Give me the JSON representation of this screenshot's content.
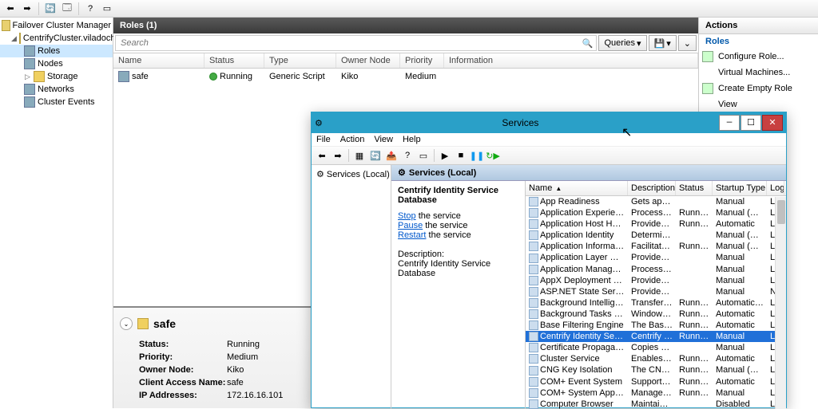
{
  "app": {
    "name": "Failover Cluster Manager"
  },
  "tree": {
    "root": "Failover Cluster Manager",
    "cluster": "CentrifyCluster.viladochave...",
    "items": [
      "Roles",
      "Nodes",
      "Storage",
      "Networks",
      "Cluster Events"
    ]
  },
  "roles": {
    "title": "Roles (1)",
    "search_ph": "Search",
    "queries": "Queries",
    "cols": {
      "name": "Name",
      "status": "Status",
      "type": "Type",
      "owner": "Owner Node",
      "priority": "Priority",
      "info": "Information"
    },
    "row": {
      "name": "safe",
      "status": "Running",
      "type": "Generic Script",
      "owner": "Kiko",
      "priority": "Medium",
      "info": ""
    }
  },
  "detail": {
    "name": "safe",
    "labels": {
      "status": "Status:",
      "priority": "Priority:",
      "owner": "Owner Node:",
      "client": "Client Access Name:",
      "ip": "IP Addresses:"
    },
    "values": {
      "status": "Running",
      "priority": "Medium",
      "owner": "Kiko",
      "client": "safe",
      "ip": "172.16.16.101"
    }
  },
  "actions": {
    "title": "Actions",
    "heading": "Roles",
    "items": [
      "Configure Role...",
      "Virtual Machines...",
      "Create Empty Role",
      "View"
    ]
  },
  "svc": {
    "title": "Services",
    "menu": [
      "File",
      "Action",
      "View",
      "Help"
    ],
    "tree": "Services (Local)",
    "pane_title": "Services (Local)",
    "selected_name": "Centrify Identity Service Database",
    "links": {
      "stop": "Stop",
      "pause": "Pause",
      "restart": "Restart"
    },
    "link_suffix": " the service",
    "desc_label": "Description:",
    "desc_text": "Centrify Identity Service Database",
    "cols": {
      "name": "Name",
      "desc": "Description",
      "status": "Status",
      "startup": "Startup Type",
      "log": "Log"
    },
    "rows": [
      {
        "name": "App Readiness",
        "desc": "Gets apps re...",
        "status": "",
        "startup": "Manual",
        "log": "Loc"
      },
      {
        "name": "Application Experience",
        "desc": "Processes a...",
        "status": "Running",
        "startup": "Manual (Trig...",
        "log": "Loc"
      },
      {
        "name": "Application Host Helper Ser...",
        "desc": "Provides ad...",
        "status": "Running",
        "startup": "Automatic",
        "log": "Loc"
      },
      {
        "name": "Application Identity",
        "desc": "Determines ...",
        "status": "",
        "startup": "Manual (Trig...",
        "log": "Loc"
      },
      {
        "name": "Application Information",
        "desc": "Facilitates t...",
        "status": "Running",
        "startup": "Manual (Trig...",
        "log": "Loc"
      },
      {
        "name": "Application Layer Gateway ...",
        "desc": "Provides su...",
        "status": "",
        "startup": "Manual",
        "log": "Loc"
      },
      {
        "name": "Application Management",
        "desc": "Processes in...",
        "status": "",
        "startup": "Manual",
        "log": "Loc"
      },
      {
        "name": "AppX Deployment Service (...",
        "desc": "Provides inf...",
        "status": "",
        "startup": "Manual",
        "log": "Loc"
      },
      {
        "name": "ASP.NET State Service",
        "desc": "Provides su...",
        "status": "",
        "startup": "Manual",
        "log": "Net"
      },
      {
        "name": "Background Intelligent Tran...",
        "desc": "Transfers fil...",
        "status": "Running",
        "startup": "Automatic (D...",
        "log": "Loc"
      },
      {
        "name": "Background Tasks Infrastru...",
        "desc": "Windows in...",
        "status": "Running",
        "startup": "Automatic",
        "log": "Loc"
      },
      {
        "name": "Base Filtering Engine",
        "desc": "The Base Fil...",
        "status": "Running",
        "startup": "Automatic",
        "log": "Loc"
      },
      {
        "name": "Centrify Identity Service Dat...",
        "desc": "Centrify Ide...",
        "status": "Running",
        "startup": "Manual",
        "log": "Loc",
        "sel": true
      },
      {
        "name": "Certificate Propagation",
        "desc": "Copies user ...",
        "status": "",
        "startup": "Manual",
        "log": "Loc"
      },
      {
        "name": "Cluster Service",
        "desc": "Enables serv...",
        "status": "Running",
        "startup": "Automatic",
        "log": "Loc"
      },
      {
        "name": "CNG Key Isolation",
        "desc": "The CNG ke...",
        "status": "Running",
        "startup": "Manual (Trig...",
        "log": "Loc"
      },
      {
        "name": "COM+ Event System",
        "desc": "Supports Sy...",
        "status": "Running",
        "startup": "Automatic",
        "log": "Loc"
      },
      {
        "name": "COM+ System Application",
        "desc": "Manages th...",
        "status": "Running",
        "startup": "Manual",
        "log": "Loc"
      },
      {
        "name": "Computer Browser",
        "desc": "Maintains a...",
        "status": "",
        "startup": "Disabled",
        "log": "Loc"
      }
    ]
  }
}
